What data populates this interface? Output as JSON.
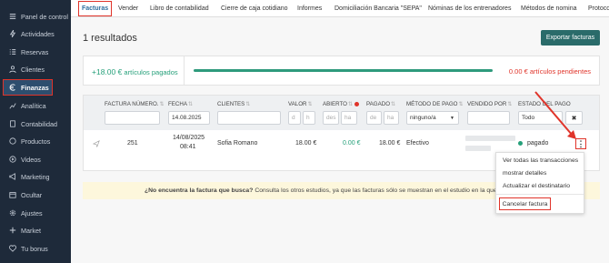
{
  "sidebar": {
    "items": [
      {
        "label": "Panel de control",
        "icon": "menu-icon"
      },
      {
        "label": "Actividades",
        "icon": "lightning-icon"
      },
      {
        "label": "Reservas",
        "icon": "list-icon"
      },
      {
        "label": "Clientes",
        "icon": "user-icon"
      },
      {
        "label": "Finanzas",
        "icon": "euro-icon",
        "active": true
      },
      {
        "label": "Analítica",
        "icon": "chart-icon"
      },
      {
        "label": "Contabilidad",
        "icon": "document-icon"
      },
      {
        "label": "Productos",
        "icon": "box-icon"
      },
      {
        "label": "Videos",
        "icon": "play-icon"
      },
      {
        "label": "Marketing",
        "icon": "megaphone-icon"
      },
      {
        "label": "Ocultar",
        "icon": "calendar-icon"
      },
      {
        "label": "Ajustes",
        "icon": "gear-icon"
      },
      {
        "label": "Market",
        "icon": "plus-icon"
      },
      {
        "label": "Tu bonus",
        "icon": "heart-icon"
      }
    ]
  },
  "tabs": [
    "Facturas",
    "Vender",
    "Libro de contabilidad",
    "Cierre de caja cotidiano",
    "Informes",
    "Domiciliación Bancaria \"SEPA\"",
    "Nóminas de los entrenadores",
    "Métodos de nomina",
    "Protoco"
  ],
  "header": {
    "results": "1 resultados",
    "export_label": "Exportar facturas"
  },
  "summary": {
    "paid_amount": "+18.00 €",
    "paid_label": "artículos pagados",
    "paid_fraction": 1.0,
    "pending_amount": "0.00 €",
    "pending_label": "artículos pendientes"
  },
  "table": {
    "columns": [
      "FACTURA NÚMERO.",
      "FECHA",
      "CLIENTES",
      "VALOR",
      "ABIERTO",
      "PAGADO",
      "MÉTODO DE PAGO",
      "VENDIDO POR",
      "ESTADO DEL PAGO"
    ],
    "filters": {
      "date": "14.08.2025",
      "valor_min": "d",
      "valor_max": "h",
      "abierto_min": "des",
      "abierto_max": "ha",
      "pagado_min": "de",
      "pagado_max": "ha",
      "method": "ninguno/a",
      "status": "Todo",
      "clear": "✖"
    },
    "row": {
      "number": "251",
      "date": "14/08/2025",
      "time": "08:41",
      "client": "Sofia Romano",
      "value": "18.00 €",
      "open": "0.00 €",
      "paid": "18.00 €",
      "method": "Efectivo",
      "status": "pagado",
      "menu": "⋮"
    }
  },
  "dropdown": {
    "items": [
      "Ver todas las transacciones",
      "mostrar detalles",
      "Actualizar el destinatario"
    ],
    "cancel": "Cancelar factura"
  },
  "notice": {
    "bold": "¿No encuentra la factura que busca?",
    "text": "Consulta los otros estudios, ya que las facturas sólo se muestran en el estudio en la que fue"
  },
  "colors": {
    "sidebar_bg": "#1e2a3a",
    "accent_teal": "#2a6b6a",
    "paid_green": "#26a07a",
    "pending_red": "#e0342a",
    "highlight_red": "#e0342a"
  }
}
